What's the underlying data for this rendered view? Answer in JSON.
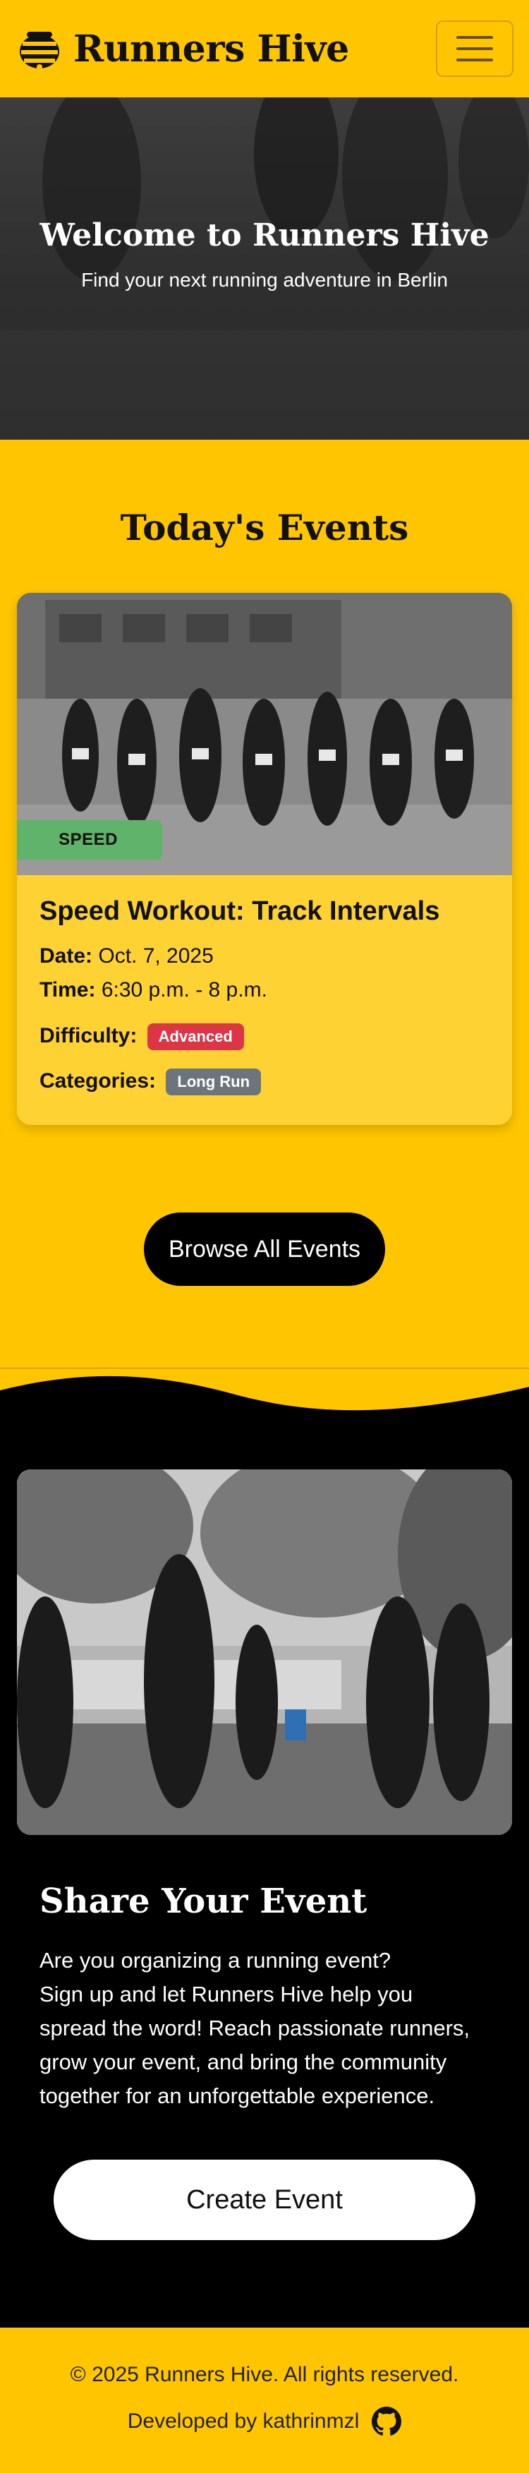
{
  "navbar": {
    "brand": "Runners Hive",
    "logo_icon": "bee-hive-icon",
    "toggler_icon": "hamburger-menu-icon"
  },
  "hero": {
    "title": "Welcome to Runners Hive",
    "subtitle": "Find your next running adventure in Berlin"
  },
  "events": {
    "title": "Today's Events",
    "card": {
      "badge": "SPEED",
      "title": "Speed Workout: Track Intervals",
      "date_label": "Date:",
      "date_value": "Oct. 7, 2025",
      "time_label": "Time:",
      "time_value": "6:30 p.m. - 8 p.m.",
      "difficulty_label": "Difficulty:",
      "difficulty_value": "Advanced",
      "categories_label": "Categories:",
      "category_value": "Long Run"
    },
    "browse_button": "Browse All Events"
  },
  "share": {
    "title": "Share Your Event",
    "lines": [
      "Are you organizing a running event?",
      "Sign up and let Runners Hive help you",
      "spread the word! Reach passionate runners,",
      "grow your event, and bring the community",
      "together for an unforgettable experience."
    ],
    "create_button": "Create Event"
  },
  "footer": {
    "copyright": "© 2025 Runners Hive. All rights reserved.",
    "developed_by": "Developed by kathrinmzl",
    "github_icon": "github-icon"
  },
  "colors": {
    "brand_yellow": "#ffc600",
    "card_yellow": "#ffd233",
    "badge_green": "#5fb36a",
    "difficulty_red": "#dc3545",
    "category_grey": "#6c757d",
    "dark": "#000000"
  }
}
